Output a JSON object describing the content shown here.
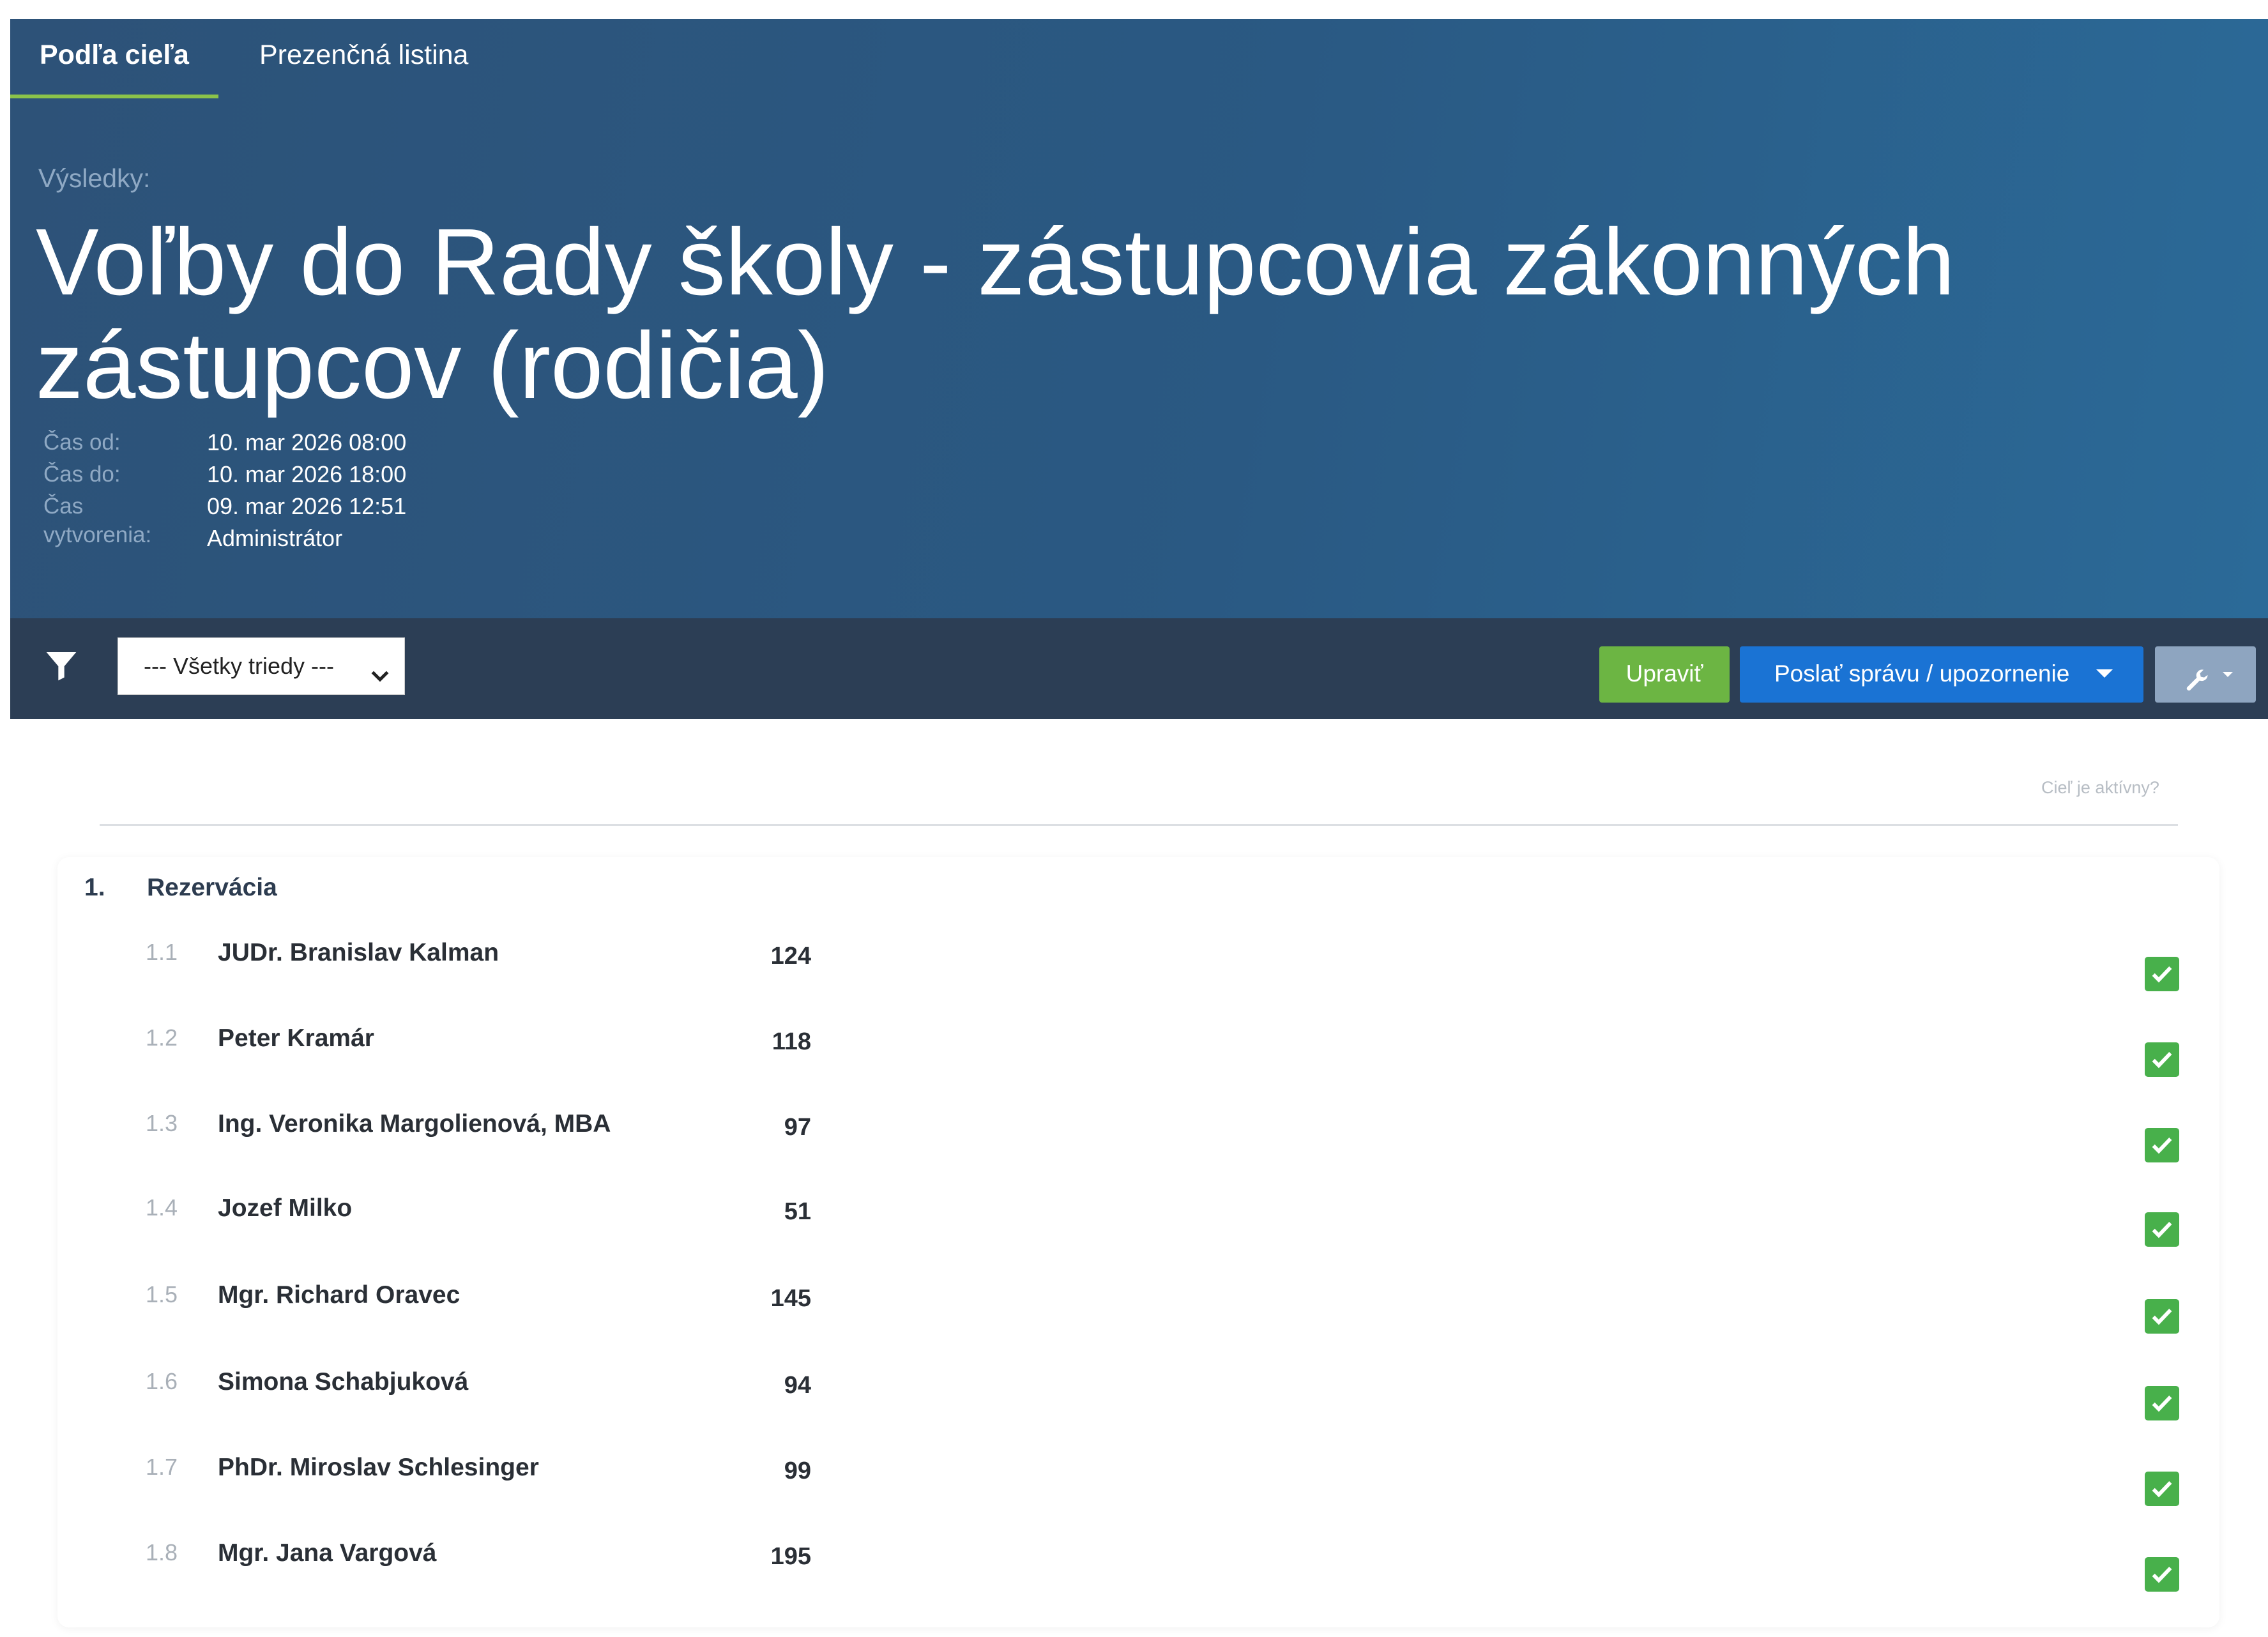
{
  "tabs": [
    {
      "label": "Podľa cieľa",
      "active": true
    },
    {
      "label": "Prezenčná listina",
      "active": false
    }
  ],
  "header": {
    "results_label": "Výsledky:",
    "title": "Voľby do Rady školy - zástupcovia zákonných zástupcov (rodičia)",
    "meta": [
      {
        "label": "Čas od:",
        "value": "10. mar 2026 08:00"
      },
      {
        "label": "Čas do:",
        "value": "10. mar 2026 18:00"
      },
      {
        "label": "Čas vytvorenia:",
        "value": "09. mar 2026 12:51"
      },
      {
        "label": "",
        "value": "Administrátor"
      }
    ]
  },
  "toolbar": {
    "filter_icon": "filter-icon",
    "class_select": "--- Všetky triedy ---",
    "edit_label": "Upraviť",
    "message_label": "Poslať správu / upozornenie",
    "tools_icon": "wrench-icon"
  },
  "active_question": "Cieľ je aktívny?",
  "section": {
    "number": "1.",
    "title": "Rezervácia",
    "candidates": [
      {
        "num": "1.1",
        "name": "JUDr. Branislav Kalman",
        "votes": "124",
        "checked": true
      },
      {
        "num": "1.2",
        "name": "Peter Kramár",
        "votes": "118",
        "checked": true
      },
      {
        "num": "1.3",
        "name": "Ing. Veronika Margolienová, MBA",
        "votes": "97",
        "checked": true
      },
      {
        "num": "1.4",
        "name": "Jozef Milko",
        "votes": "51",
        "checked": true
      },
      {
        "num": "1.5",
        "name": "Mgr. Richard Oravec",
        "votes": "145",
        "checked": true
      },
      {
        "num": "1.6",
        "name": "Simona Schabjuková",
        "votes": "94",
        "checked": true
      },
      {
        "num": "1.7",
        "name": "PhDr. Miroslav Schlesinger",
        "votes": "99",
        "checked": true
      },
      {
        "num": "1.8",
        "name": "Mgr. Jana Vargová",
        "votes": "195",
        "checked": true
      }
    ]
  },
  "colors": {
    "header_bg": "#2a5983",
    "toolbar_bg": "#2c3e55",
    "active_tab_underline": "#8bc34a",
    "edit_button": "#6cb543",
    "message_button": "#1a73d4",
    "tools_button": "#8ea5c0",
    "check_green": "#48b04b"
  }
}
